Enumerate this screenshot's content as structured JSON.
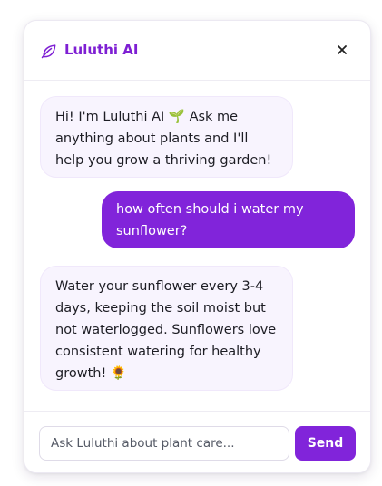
{
  "header": {
    "title": "Luluthi AI",
    "icon": "leaf-icon",
    "close_icon": "close-icon",
    "accent_color": "#7e1fd3"
  },
  "messages": [
    {
      "role": "assistant",
      "text": "Hi! I'm Luluthi AI 🌱 Ask me anything about plants and I'll help you grow a thriving garden!"
    },
    {
      "role": "user",
      "text": "how often should i water my sunflower?"
    },
    {
      "role": "assistant",
      "text": "Water your sunflower every 3-4 days, keeping the soil moist but not waterlogged. Sunflowers love consistent watering for healthy growth! 🌻"
    }
  ],
  "composer": {
    "placeholder": "Ask Luluthi about plant care...",
    "value": "",
    "send_label": "Send",
    "button_color": "#8124da"
  }
}
